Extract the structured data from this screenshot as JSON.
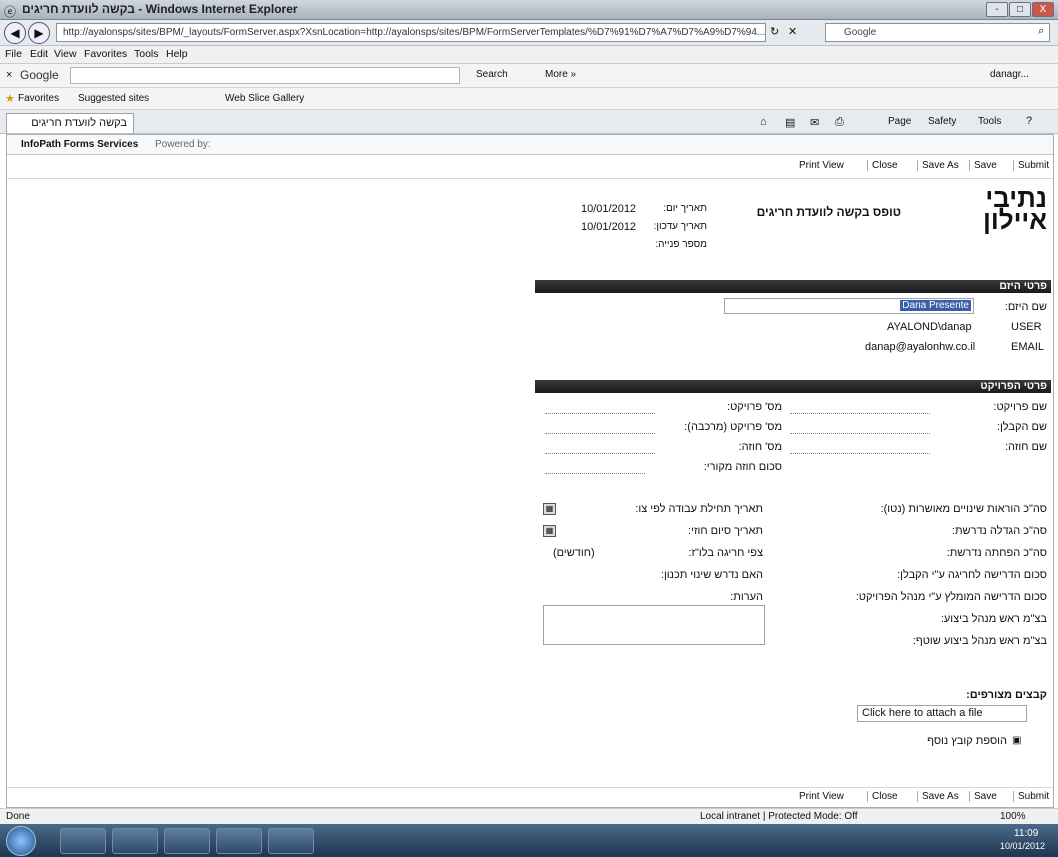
{
  "window": {
    "title": "בקשה לוועדת חריגים - Windows Internet Explorer",
    "min": "-",
    "max": "□",
    "close": "X"
  },
  "address": {
    "url": "http://ayalonsps/sites/BPM/_layouts/FormServer.aspx?XsnLocation=http://ayalonsps/sites/BPM/FormServerTemplates/%D7%91%D7%A7%D7%A9%D7%94...",
    "search_placeholder": "Google"
  },
  "menu": [
    "File",
    "Edit",
    "View",
    "Favorites",
    "Tools",
    "Help"
  ],
  "google_bar": {
    "logo": "Google",
    "search": "Search",
    "more": "More »",
    "user": "danagr..."
  },
  "favorites": {
    "label": "Favorites",
    "suggested": "Suggested sites",
    "gallery": "Web Slice Gallery"
  },
  "tab": {
    "title": "בקשה לוועדת חריגים"
  },
  "cmdbar": {
    "page": "Page",
    "safety": "Safety",
    "tools": "Tools"
  },
  "infopath": {
    "label": "InfoPath Forms Services",
    "powered": "Powered by:"
  },
  "toolbar": {
    "print": "Print View",
    "close": "Close",
    "save_as": "Save As",
    "save": "Save",
    "submit": "Submit"
  },
  "form": {
    "logo_line1": "נתיבי",
    "logo_line2": "איילון",
    "title": "טופס בקשה לוועדת חריגים",
    "date_label": "תאריך יום:",
    "date_value": "10/01/2012",
    "updated_label": "תאריך עדכון:",
    "updated_value": "10/01/2012",
    "number_label": "מספר פנייה:",
    "section1": "פרטי היזם",
    "name_label": "שם היזם:",
    "name_value": "Dana Presente",
    "user_label": "USER",
    "user_value": "AYALOND\\danap",
    "email_label": "EMAIL",
    "email_value": "danap@ayalonhw.co.il",
    "section2": "פרטי הפרויקט",
    "right_col": [
      "שם פרויקט:",
      "שם הקבלן:",
      "שם חוזה:"
    ],
    "mid_col": [
      "מס' פרויקט:",
      "מס' פרויקט (מרכבה):",
      "מס' חוזה:",
      "סכום חוזה מקורי:"
    ],
    "right_col2": [
      "סה\"כ הוראות שינויים מאושרות (נטו):",
      "סה\"כ הגדלה נדרשת:",
      "סה\"כ הפחתה נדרשת:",
      "סכום הדרישה לחריגה ע\"י הקבלן:",
      "סכום הדרישה המומלץ ע\"י מנהל הפרויקט:",
      "בצ\"מ ראש מנהל ביצוע:",
      "בצ\"מ ראש מנהל ביצוע שוטף:"
    ],
    "mid_col2": [
      "תאריך תחילת עבודה לפי צו:",
      "תאריך סיום חוזי:",
      "צפי חריגה בלו\"ז:",
      "האם נדרש שינוי תכנון:",
      "הערות:"
    ],
    "months_label": "(חודשים)",
    "attach_label": "קבצים מצורפים:",
    "attach_link": "Click here to attach a file",
    "add_file": "הוספת קובץ נוסף"
  },
  "status": {
    "done": "Done",
    "zone": "Local intranet | Protected Mode: Off",
    "zoom": "100%"
  },
  "taskbar": {
    "time": "11:09",
    "date": "10/01/2012"
  }
}
